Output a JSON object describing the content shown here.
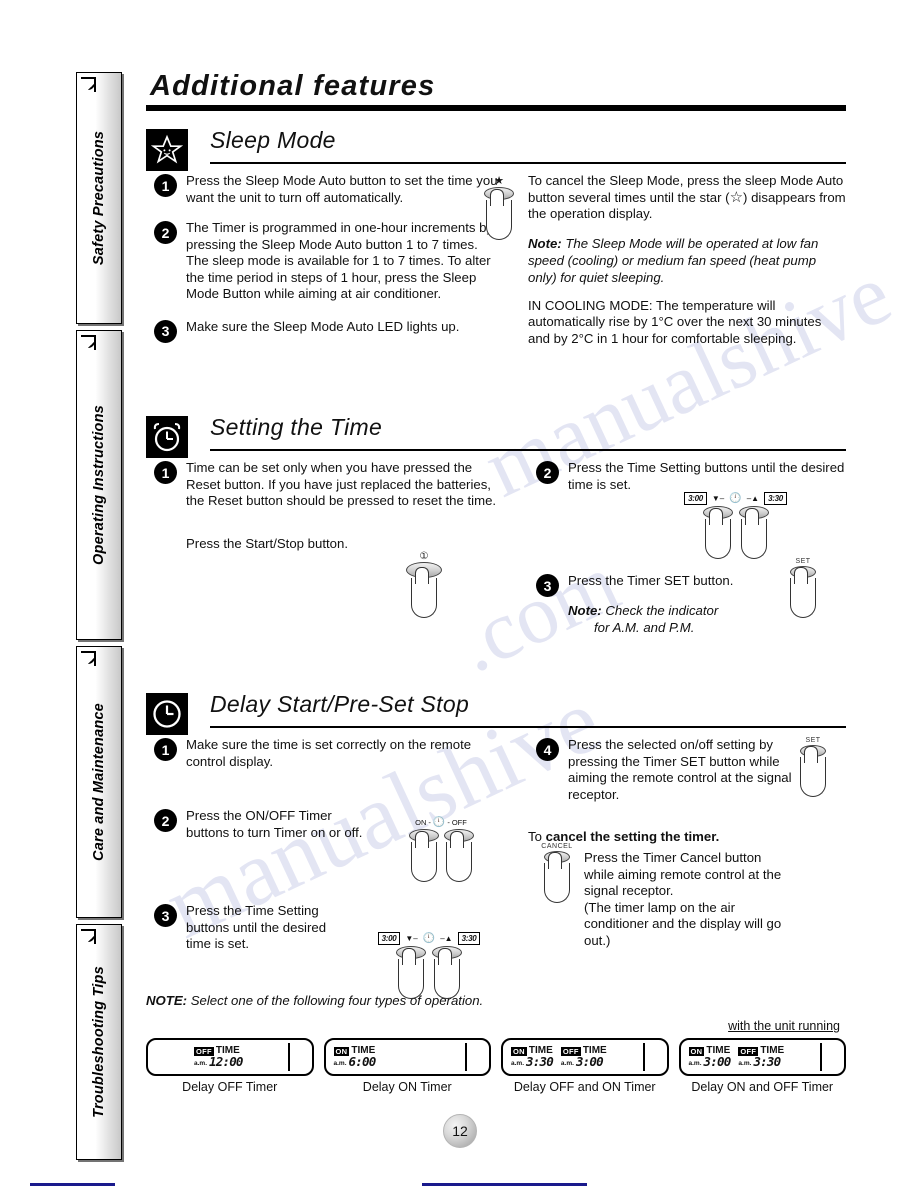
{
  "page": {
    "heading": "Additional features",
    "number": "12",
    "watermark": [
      "manualshive",
      ".com",
      "manualshive"
    ]
  },
  "sidebar": {
    "tabs": [
      {
        "label": "Safety Precautions",
        "icon": "bookmark-corner-icon"
      },
      {
        "label": "Operating Instructions",
        "icon": "bookmark-corner-icon"
      },
      {
        "label": "Care and Maintenance",
        "icon": "bookmark-corner-icon"
      },
      {
        "label": "Troubleshooting Tips",
        "icon": "bookmark-corner-icon"
      }
    ]
  },
  "sleep_mode": {
    "title": "Sleep Mode",
    "icon": "star-badge-icon",
    "steps": [
      {
        "num": "1",
        "text": "Press the Sleep Mode Auto button to set the time you want the unit to turn off automatically."
      },
      {
        "num": "2",
        "text": "The Timer is programmed in one-hour increments by pressing the Sleep Mode Auto button 1 to 7 times.\nThe sleep mode is available for 1 to 7 times. To alter the time period in steps of 1 hour, press the Sleep Mode Button while aiming at air conditioner."
      },
      {
        "num": "3",
        "text": "Make sure the Sleep Mode Auto LED lights up."
      }
    ],
    "cancel_text_a": "To cancel the Sleep Mode, press the sleep Mode Auto button several times until the star",
    "cancel_text_b": ") disappears from the operation display.",
    "note_label": "Note:",
    "note_text": "The Sleep Mode will be operated at low fan speed (cooling) or medium fan speed (heat pump only) for quiet sleeping.",
    "cooling_text": "IN COOLING MODE: The temperature will automatically rise by 1°C over the next 30 minutes and by 2°C in 1 hour for comfortable sleeping.",
    "button_caption": "sleep-mode-key"
  },
  "setting_time": {
    "title": "Setting the Time",
    "icon": "alarm-clock-icon",
    "steps": [
      {
        "num": "1",
        "text": "Time can be set only when you have pressed the Reset button. If you have just replaced the batteries, the Reset button should be pressed to reset the time."
      },
      {
        "num": "2",
        "text": "Press the Time Setting buttons until the desired time is set."
      },
      {
        "num": "3",
        "text": "Press the Timer SET button."
      }
    ],
    "start_stop_text": "Press the Start/Stop button.",
    "note_label": "Note:",
    "note_text_1": "Check the indicator",
    "note_text_2": "for A.M. and P.M.",
    "time_keys": {
      "left_tag": "3:00",
      "right_tag": "3:30",
      "down_glyph": "▼",
      "up_glyph": "▲",
      "clock_glyph": "◔"
    },
    "set_key_label": "SET"
  },
  "delay_start": {
    "title": "Delay Start/Pre-Set Stop",
    "icon": "clock-icon",
    "steps": [
      {
        "num": "1",
        "text": "Make sure the time is set correctly on the remote control display."
      },
      {
        "num": "2",
        "text": "Press the ON/OFF Timer buttons to turn Timer on or off."
      },
      {
        "num": "3",
        "text": "Press the Time Setting buttons until the desired time is set."
      },
      {
        "num": "4",
        "text": "Press the selected on/off setting by pressing the Timer SET button while aiming the remote control at the signal receptor."
      }
    ],
    "cancel_heading_a": "To",
    "cancel_heading_b": "cancel the setting the timer.",
    "cancel_text": "Press the Timer Cancel button while aiming remote control at the signal receptor.\n(The timer lamp on the air conditioner and the display will go out.)",
    "onoff_key_labels": {
      "on": "ON",
      "off": "OFF",
      "clock": "◔"
    },
    "time_keys": {
      "left_tag": "3:00",
      "right_tag": "3:30"
    },
    "set_key_label": "SET",
    "cancel_key_label": "CANCEL"
  },
  "footer_note": {
    "label": "NOTE:",
    "text": "Select one of the following four types of operation.",
    "unit_running_label": "with the unit running"
  },
  "panels": [
    {
      "caption": "Delay OFF Timer",
      "indent": true,
      "times": [
        {
          "chip": "OFF",
          "word": "TIME",
          "ampm": "a.m.",
          "value": "12:00"
        }
      ]
    },
    {
      "caption": "Delay ON Timer",
      "indent": false,
      "times": [
        {
          "chip": "ON",
          "word": "TIME",
          "ampm": "a.m.",
          "value": "6:00"
        }
      ]
    },
    {
      "caption": "Delay OFF and ON Timer",
      "indent": false,
      "times": [
        {
          "chip": "ON",
          "word": "TIME",
          "ampm": "a.m.",
          "value": "3:30"
        },
        {
          "chip": "OFF",
          "word": "TIME",
          "ampm": "a.m.",
          "value": "3:00"
        }
      ]
    },
    {
      "caption": "Delay ON and OFF Timer",
      "indent": false,
      "times": [
        {
          "chip": "ON",
          "word": "TIME",
          "ampm": "a.m.",
          "value": "3:00"
        },
        {
          "chip": "OFF",
          "word": "TIME",
          "ampm": "a.m.",
          "value": "3:30"
        }
      ]
    }
  ],
  "colors": {
    "ink": "#000000",
    "blue_rule": "#1a1a8c",
    "watermark": "#cdd0ea"
  }
}
